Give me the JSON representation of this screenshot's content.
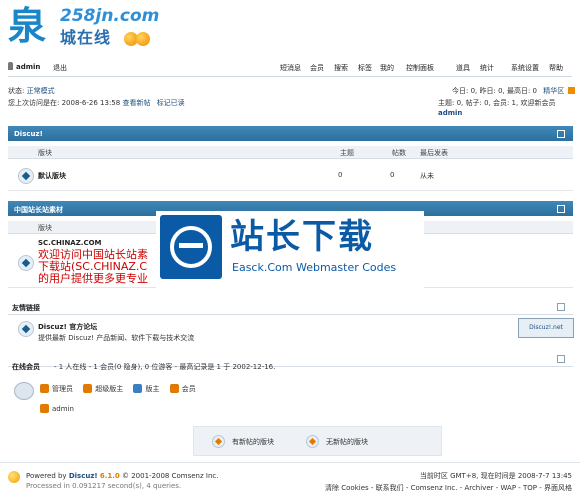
{
  "header": {
    "logo_glyph": "泉",
    "logo_domain": "258jn.com",
    "logo_text": "城在线"
  },
  "nav": {
    "username": "admin",
    "logout": "退出",
    "links": [
      "短消息",
      "会员",
      "搜索",
      "标签",
      "我的",
      "控制面板",
      "道具",
      "统计",
      "系统设置",
      "帮助"
    ]
  },
  "status": {
    "state_label": "状态:",
    "state_value": "正常模式",
    "last_visit": "您上次访问是在: 2008-6-26 13:58",
    "view_new": "查看新帖",
    "mark_read": "标记已读",
    "today_stats": "今日: 0, 昨日: 0, 最高日: 0",
    "digest": "精华区",
    "topic_stats": "主题: 0, 帖子: 0, 会员: 1, 欢迎新会员",
    "new_member": "admin"
  },
  "category_discuz": {
    "title": "Discuz!",
    "col_forum": "版块",
    "col_topics": "主题",
    "col_posts": "帖数",
    "col_lastpost": "最后发表",
    "forum_name": "默认版块",
    "topics": "0",
    "posts": "0",
    "lastpost": "从未"
  },
  "category_chinaz": {
    "title": "中国站长站素材",
    "col_forum": "版块",
    "forum_name": "SC.CHINAZ.COM",
    "desc_line1": "欢迎访问中国站长站素",
    "desc_line2": "下载站(SC.CHINAZ.C",
    "desc_line3": "的用户提供更多更专业"
  },
  "friend_links": {
    "title": "友情链接",
    "site_name": "Discuz! 官方论坛",
    "site_desc": "提供最新 Discuz! 产品新闻、软件下载与技术交流",
    "badge": "Discuz!.net"
  },
  "online": {
    "title": "在线会员",
    "summary": "- 1 人在线 - 1 会员(0 隐身), 0 位游客 - 最高记录是 1 于 2002-12-16.",
    "legend": [
      "管理员",
      "超级版主",
      "版主",
      "会员"
    ],
    "user": "admin"
  },
  "legend_bar": {
    "new": "有新帖的版块",
    "none": "无新帖的版块"
  },
  "footer": {
    "powered": "Powered by",
    "product": "Discuz!",
    "version": "6.1.0",
    "copyright": "© 2001-2008 Comsenz Inc.",
    "processed": "Processed in 0.091217 second(s), 4 queries.",
    "time": "当前时区 GMT+8, 现在时间是 2008-7-7 13:45",
    "links": "清除 Cookies - 联系我们 - Comsenz Inc. - Archiver - WAP - TOP - 界面风格"
  },
  "watermark": {
    "cn": "站长下载",
    "en": "Easck.Com Webmaster Codes"
  },
  "colors": {
    "accent": "#2d6f9e",
    "link": "#1c4d80",
    "logo": "#1a86c8"
  }
}
